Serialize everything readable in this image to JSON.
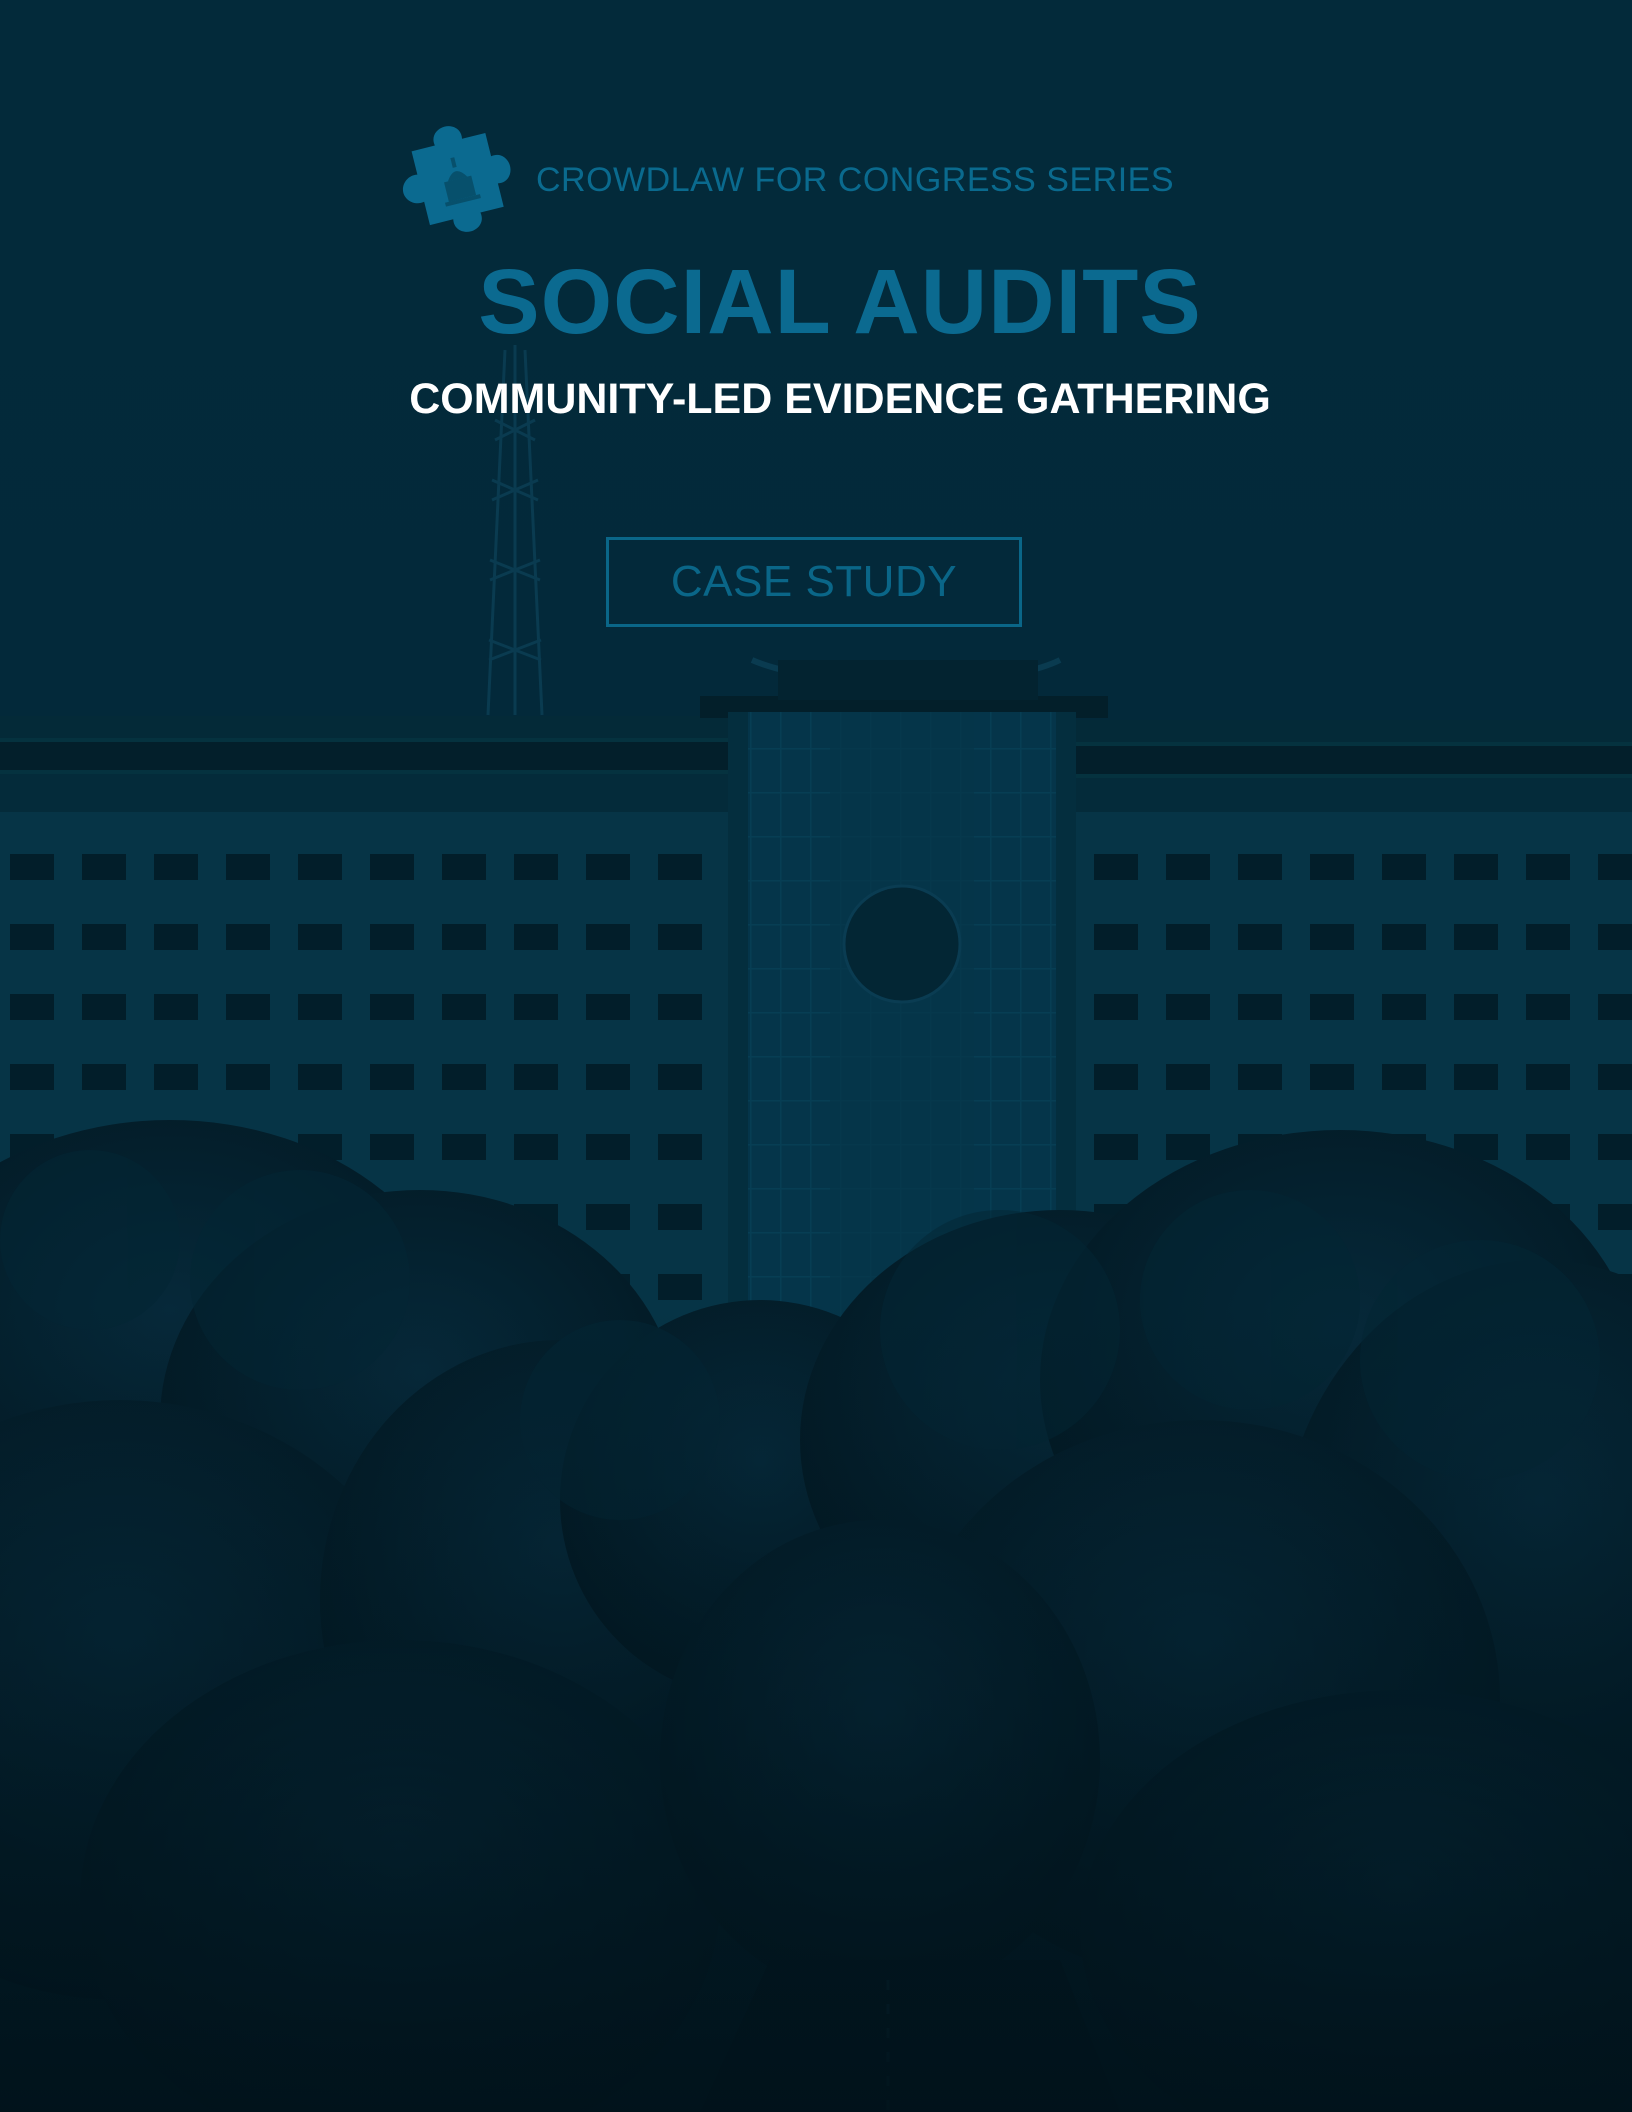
{
  "header": {
    "series_label": "CROWDLAW FOR CONGRESS SERIES"
  },
  "cover": {
    "title": "SOCIAL AUDITS",
    "subtitle": "COMMUNITY-LED EVIDENCE GATHERING",
    "badge_label": "CASE STUDY"
  },
  "colors": {
    "accent": "#0b6a90",
    "background": "#03293a",
    "subtitle": "#ffffff"
  },
  "icons": {
    "logo": "puzzle-piece-capitol-icon"
  }
}
